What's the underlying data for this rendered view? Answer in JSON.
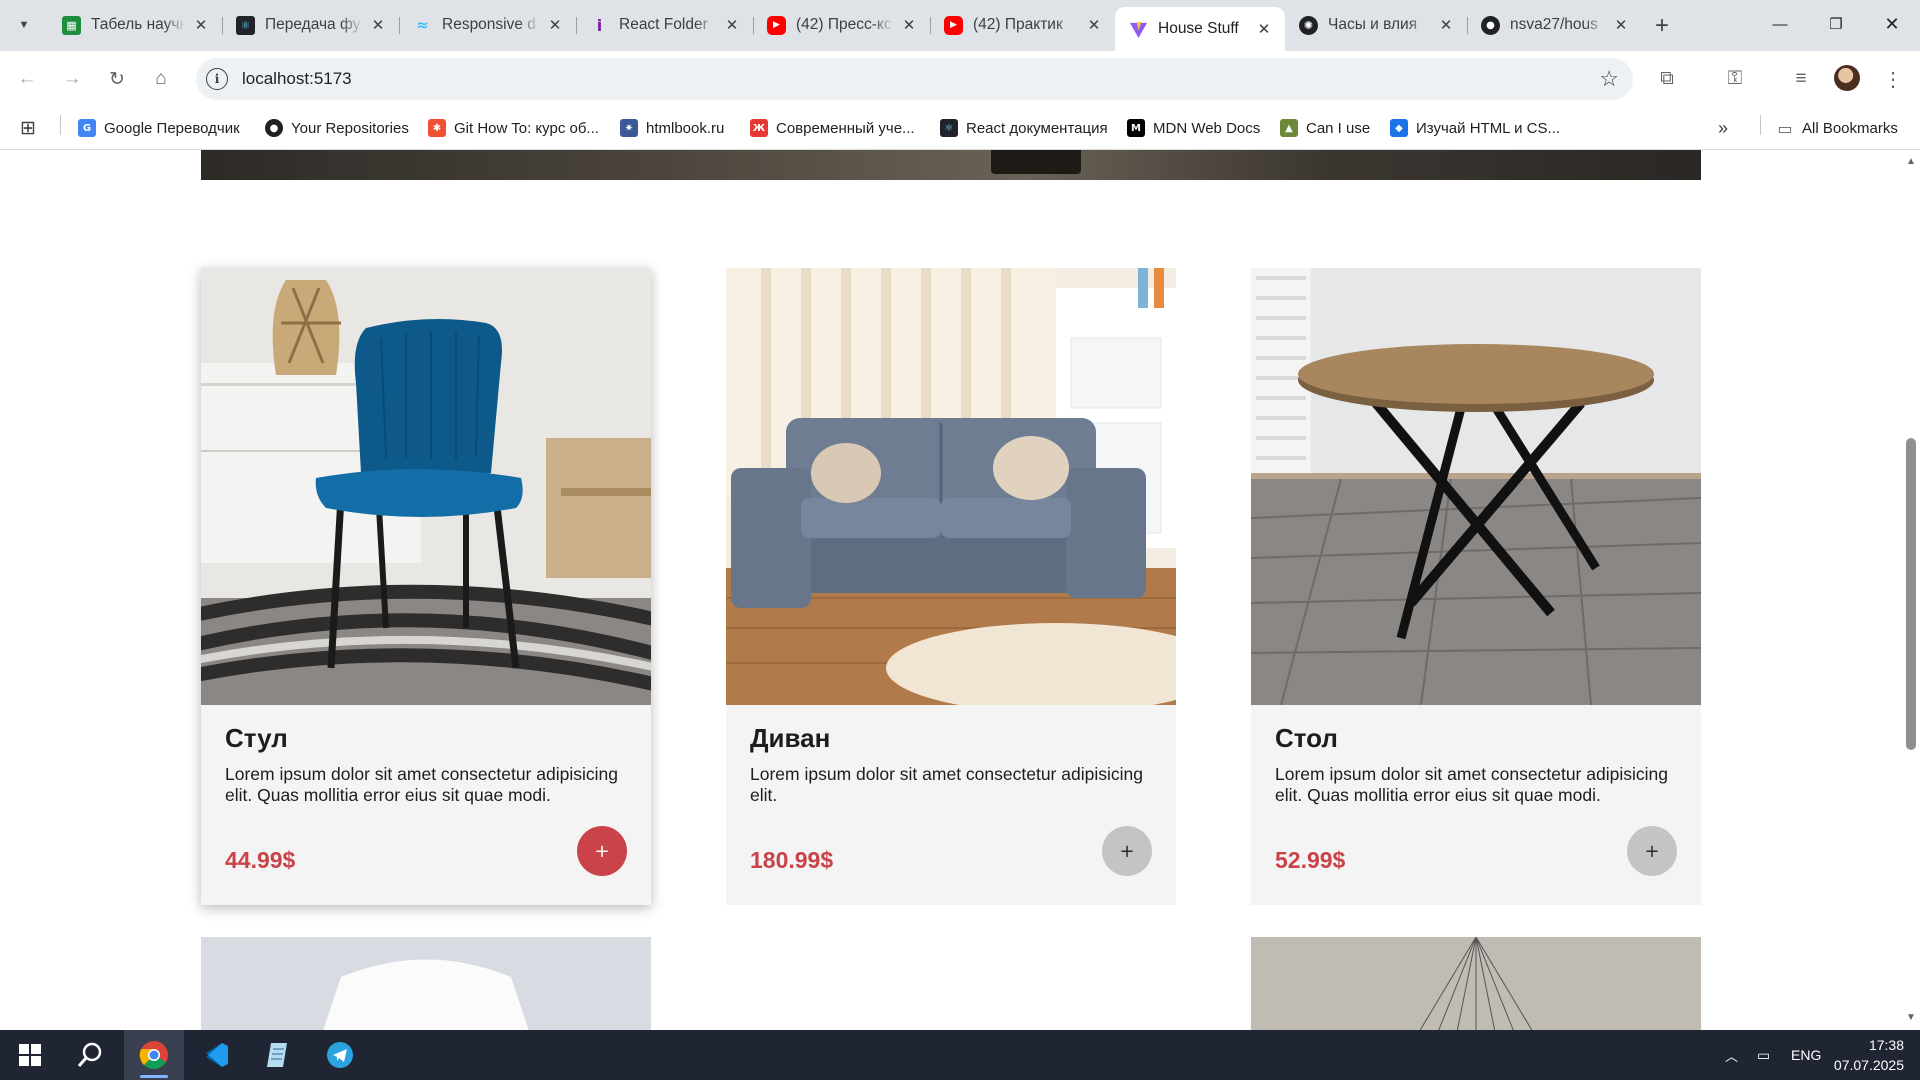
{
  "tabs": [
    {
      "title": "Табель научн",
      "favicon": "sheets-icon",
      "color": "#1e8e3e"
    },
    {
      "title": "Передача фу",
      "favicon": "react-icon",
      "color": "#20232a"
    },
    {
      "title": "Responsive d",
      "favicon": "tailwind-icon",
      "color": "#38bdf8"
    },
    {
      "title": "React Folder",
      "favicon": "info-icon",
      "color": "#7b1fa2"
    },
    {
      "title": "(42) Пресс-кс",
      "favicon": "youtube-icon",
      "color": "#ff0000"
    },
    {
      "title": "(42) Практик",
      "favicon": "youtube-icon",
      "color": "#ff0000"
    },
    {
      "title": "House Stuff",
      "favicon": "vite-icon",
      "color": "#8b5cf6"
    },
    {
      "title": "Часы и влия",
      "favicon": "openai-icon",
      "color": "#202124"
    },
    {
      "title": "nsva27/hous",
      "favicon": "github-icon",
      "color": "#202124"
    }
  ],
  "address": {
    "url": "localhost:5173"
  },
  "bookmarks": [
    {
      "label": "Google Переводчик",
      "icon": "google-translate-icon",
      "color": "#4285f4"
    },
    {
      "label": "Your Repositories",
      "icon": "github-icon",
      "color": "#202124"
    },
    {
      "label": "Git How To: курс об...",
      "icon": "git-icon",
      "color": "#f05033"
    },
    {
      "label": "htmlbook.ru",
      "icon": "htmlbook-icon",
      "color": "#3b5998"
    },
    {
      "label": "Современный уче...",
      "icon": "js-info-icon",
      "color": "#e53935"
    },
    {
      "label": "React документация",
      "icon": "react-icon",
      "color": "#20232a"
    },
    {
      "label": "MDN Web Docs",
      "icon": "mdn-icon",
      "color": "#000000"
    },
    {
      "label": "Can I use",
      "icon": "caniuse-icon",
      "color": "#6c8a3a"
    },
    {
      "label": "Изучай HTML и CS...",
      "icon": "htmlacademy-icon",
      "color": "#1a73e8"
    },
    {
      "label": "All Bookmarks",
      "icon": "folder-icon",
      "color": "#5f6368"
    }
  ],
  "products": [
    {
      "name": "Стул",
      "description": "Lorem ipsum dolor sit amet consectetur adipisicing elit. Quas mollitia error eius sit quae modi.",
      "price": "44.99$",
      "add_label": "+"
    },
    {
      "name": "Диван",
      "description": "Lorem ipsum dolor sit amet consectetur adipisicing elit.",
      "price": "180.99$",
      "add_label": "+"
    },
    {
      "name": "Стол",
      "description": "Lorem ipsum dolor sit amet consectetur adipisicing elit. Quas mollitia error eius sit quae modi.",
      "price": "52.99$",
      "add_label": "+"
    }
  ],
  "colors": {
    "accent": "#c94348",
    "button_idle": "#c4c4c4",
    "card_bg": "#f4f4f4"
  },
  "taskbar": {
    "apps": [
      "start-icon",
      "search-icon",
      "chrome-icon",
      "vscode-icon",
      "notepad-icon",
      "telegram-icon"
    ]
  },
  "tray": {
    "language": "ENG",
    "time": "17:38",
    "date": "07.07.2025"
  }
}
